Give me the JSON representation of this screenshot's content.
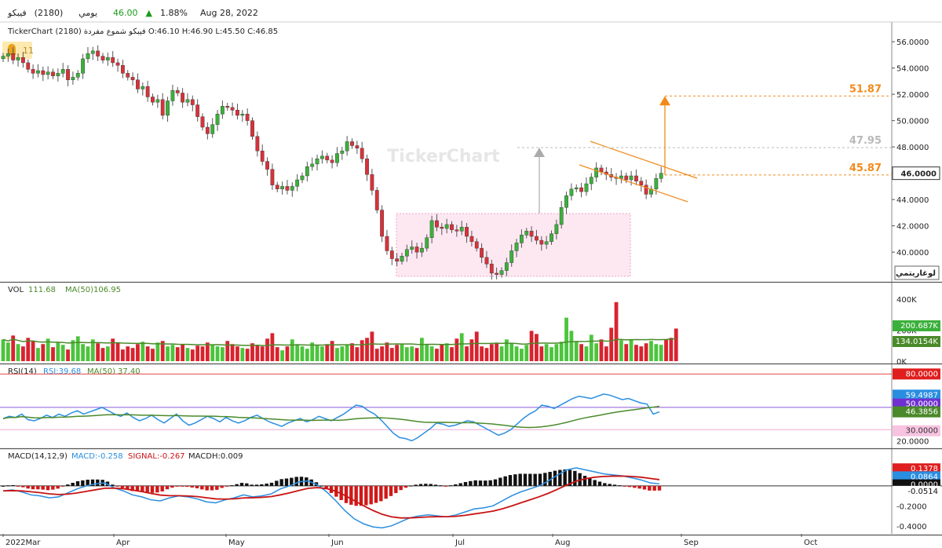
{
  "header": {
    "name": "فيبكو",
    "code": "(2180)",
    "period": "يومي",
    "price": "46.00",
    "arrow": "▲",
    "change_pct": "1.88%",
    "date": "Aug 28, 2022",
    "up_color": "#1a9b1a"
  },
  "subheader": {
    "brand": "TickerChart",
    "description": "فيبكو شموع مفردة (2180) O:46.10 H:46.90 L:45.50 C:46.85"
  },
  "alert_badge": {
    "count": "11",
    "icon": "bell-icon"
  },
  "watermark": "TickerChart",
  "log_button": "لوغاريتمي",
  "colors": {
    "up": "#3bb03b",
    "down": "#d8323a",
    "ma": "#4a8a2a",
    "rsi": "#2a8ee0",
    "signal": "#c81414",
    "target": "#f28a1a"
  },
  "chart_data": [
    {
      "type": "candlestick",
      "panel": "price",
      "ylim": [
        37.8,
        57.5
      ],
      "yticks": [
        "56.0000",
        "54.0000",
        "52.0000",
        "50.0000",
        "48.0000",
        "46.0000",
        "44.0000",
        "42.0000",
        "40.0000"
      ],
      "xticks": [
        "2022Mar",
        "Apr",
        "May",
        "Jun",
        "Jul",
        "Aug",
        "Sep",
        "Oct"
      ],
      "last_price_label": "46.0000",
      "annotations": [
        {
          "label": "51.87",
          "value": 51.87
        },
        {
          "label": "47.95",
          "value": 47.95
        },
        {
          "label": "45.87",
          "value": 45.87
        }
      ],
      "close": [
        54.9,
        55.1,
        54.6,
        54.8,
        54.4,
        53.9,
        53.6,
        53.8,
        53.5,
        53.7,
        53.4,
        53.6,
        53.9,
        53.1,
        53.3,
        53.6,
        54.7,
        55.1,
        55.3,
        54.9,
        54.6,
        54.8,
        54.4,
        54.2,
        53.6,
        53.3,
        53.1,
        52.4,
        52.6,
        51.8,
        51.4,
        51.6,
        50.4,
        51.5,
        52.3,
        52.1,
        51.4,
        51.6,
        51.2,
        50.3,
        49.5,
        49.0,
        49.7,
        50.5,
        51.1,
        51.0,
        50.8,
        50.4,
        50.5,
        50.0,
        48.8,
        47.7,
        46.9,
        46.3,
        45.1,
        44.8,
        45.0,
        44.7,
        45.0,
        45.5,
        45.8,
        46.5,
        46.7,
        47.1,
        47.3,
        47.0,
        46.8,
        47.5,
        47.7,
        48.4,
        48.1,
        47.9,
        47.1,
        45.9,
        44.7,
        43.2,
        41.2,
        40.1,
        39.5,
        39.3,
        39.7,
        40.2,
        40.4,
        40.0,
        40.3,
        41.1,
        42.4,
        41.9,
        41.8,
        42.1,
        41.7,
        41.6,
        41.9,
        41.2,
        40.8,
        40.3,
        39.6,
        39.1,
        38.4,
        38.3,
        38.6,
        39.2,
        40.1,
        40.7,
        41.3,
        41.6,
        41.2,
        40.9,
        40.6,
        40.8,
        41.4,
        42.1,
        43.4,
        44.3,
        44.8,
        44.9,
        44.6,
        45.2,
        45.7,
        46.4,
        46.1,
        45.9,
        45.7,
        45.6,
        45.8,
        45.5,
        45.8,
        45.4,
        45.1,
        44.4,
        44.8,
        45.6,
        46.0
      ]
    },
    {
      "type": "bar",
      "panel": "volume",
      "title": "VOL",
      "value_label": "111.68",
      "ma_label": "MA(50)",
      "ma_value": "106.95",
      "ylim": [
        0,
        450
      ],
      "yticks": [
        "400K",
        "200K",
        "0K"
      ],
      "labels": [
        "200.687K",
        "134.0154K"
      ],
      "values": [
        140,
        120,
        165,
        110,
        95,
        150,
        130,
        85,
        110,
        145,
        90,
        120,
        105,
        75,
        135,
        160,
        110,
        95,
        140,
        115,
        85,
        95,
        145,
        120,
        75,
        95,
        85,
        110,
        125,
        95,
        80,
        120,
        130,
        95,
        105,
        90,
        110,
        85,
        75,
        100,
        95,
        120,
        105,
        95,
        90,
        130,
        110,
        95,
        85,
        80,
        115,
        105,
        95,
        145,
        180,
        90,
        70,
        95,
        140,
        110,
        95,
        80,
        120,
        105,
        95,
        110,
        130,
        85,
        95,
        105,
        115,
        90,
        135,
        150,
        190,
        80,
        95,
        120,
        85,
        105,
        110,
        90,
        95,
        85,
        150,
        110,
        95,
        80,
        105,
        115,
        90,
        145,
        180,
        95,
        140,
        190,
        95,
        85,
        110,
        120,
        95,
        140,
        115,
        95,
        80,
        105,
        195,
        175,
        95,
        110,
        90,
        110,
        125,
        280,
        195,
        130,
        110,
        95,
        170,
        115,
        140,
        95,
        215,
        380,
        135,
        110,
        140,
        105,
        95,
        115,
        130,
        110,
        105,
        140,
        150,
        210
      ]
    },
    {
      "type": "line",
      "panel": "rsi",
      "title": "RSI(14)",
      "rsi_label": "RSI:39.68",
      "ma_label": "MA(50)",
      "ma_value": "37.40",
      "ylim": [
        14,
        88
      ],
      "yticks": [
        "20.0000"
      ],
      "labels": [
        "80.0000",
        "59.4987",
        "50.0000",
        "46.3856",
        "30.0000"
      ],
      "rsi": [
        40,
        42,
        41,
        44,
        39,
        38,
        40,
        43,
        41,
        44,
        42,
        45,
        47,
        44,
        46,
        48,
        50,
        47,
        44,
        42,
        45,
        41,
        38,
        40,
        43,
        39,
        36,
        40,
        44,
        38,
        34,
        36,
        39,
        42,
        40,
        37,
        41,
        38,
        36,
        38,
        41,
        43,
        40,
        37,
        35,
        33,
        36,
        38,
        40,
        37,
        39,
        42,
        40,
        38,
        41,
        44,
        48,
        52,
        51,
        47,
        44,
        39,
        33,
        27,
        23,
        22,
        20,
        23,
        27,
        31,
        36,
        35,
        33,
        34,
        36,
        38,
        37,
        34,
        31,
        28,
        25,
        27,
        30,
        35,
        40,
        44,
        47,
        52,
        51,
        49,
        52,
        55,
        58,
        60,
        59,
        58,
        60,
        62,
        61,
        59,
        57,
        58,
        56,
        54,
        53,
        44,
        46
      ]
    },
    {
      "type": "line",
      "panel": "macd",
      "title": "MACD(14,12,9)",
      "macd_label": "MACD:-0.258",
      "signal_label": "SIGNAL:-0.267",
      "macdh_label": "MACDH:0.009",
      "ylim": [
        -0.48,
        0.36
      ],
      "yticks": [
        "0.2000",
        "0.0000",
        "-0.2000",
        "-0.4000"
      ],
      "labels": [
        "0.1378",
        "0.0864",
        "0.0000",
        "-0.0514"
      ],
      "macd": [
        -0.05,
        -0.04,
        -0.06,
        -0.09,
        -0.1,
        -0.12,
        -0.11,
        -0.07,
        -0.03,
        0.0,
        0.02,
        0.03,
        -0.02,
        -0.05,
        -0.09,
        -0.11,
        -0.14,
        -0.15,
        -0.12,
        -0.1,
        -0.11,
        -0.13,
        -0.16,
        -0.17,
        -0.14,
        -0.12,
        -0.09,
        -0.11,
        -0.1,
        -0.08,
        -0.03,
        0.0,
        0.04,
        0.05,
        0.01,
        -0.06,
        -0.15,
        -0.25,
        -0.33,
        -0.38,
        -0.41,
        -0.42,
        -0.4,
        -0.36,
        -0.32,
        -0.3,
        -0.29,
        -0.3,
        -0.31,
        -0.29,
        -0.26,
        -0.23,
        -0.22,
        -0.2,
        -0.15,
        -0.1,
        -0.06,
        -0.03,
        0.0,
        0.05,
        0.11,
        0.16,
        0.18,
        0.16,
        0.14,
        0.12,
        0.11,
        0.1,
        0.08,
        0.06,
        0.03,
        0.02
      ]
    }
  ]
}
